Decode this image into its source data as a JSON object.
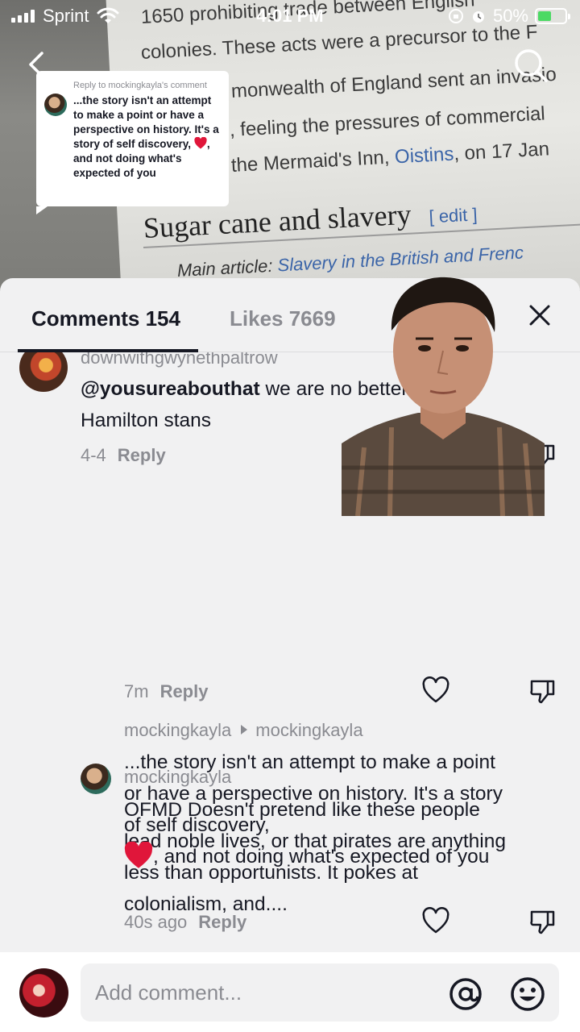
{
  "background": {
    "lines": [
      {
        "text": "1650 prohibiting trade between English",
        "link": ""
      },
      {
        "text": "colonies. These acts were a precursor to the F",
        "link": ""
      },
      {
        "text": "monwealth of England sent an invasio",
        "link": ""
      },
      {
        "text": ", feeling the pressures of commercial",
        "link": ""
      },
      {
        "text": "the Mermaid's Inn, ",
        "link": "Oistins",
        "suffix": ", on 17 Jan"
      }
    ],
    "heading": "Sugar cane and slavery",
    "edit_label": "[ edit ]",
    "sub_prefix": "Main article: ",
    "sub_link": "Slavery in the British and Frenc"
  },
  "status": {
    "carrier": "Sprint",
    "time": "4:01 PM",
    "battery": "50%",
    "battery_level": 0.5,
    "colors": {
      "battery": "#4cd964"
    }
  },
  "reply_sticker": {
    "header": "Reply to mockingkayla's comment",
    "text_before": "...the story isn't an attempt to make a point or have a perspective on history. It's a story of self discovery,",
    "text_after": ", and not doing what's expected of you"
  },
  "sheet": {
    "comments_tab": "Comments 154",
    "likes_tab": "Likes 7669"
  },
  "comments": [
    {
      "username": "downwithgwynethpaltrow",
      "mention": "@yousureabouthat",
      "text": " we are no better than Hamilton stans",
      "time": "4-4",
      "reply_label": "Reply"
    },
    {
      "username": "mockingkayla",
      "text": "OFMD Doesn't pretend like these people lead noble lives, or that pirates are anything less than opportunists. It pokes at colonialism, and....",
      "time": "7m",
      "reply_label": "Reply"
    },
    {
      "username": "mockingkayla",
      "reply_to": "mockingkayla",
      "text_before": "...the story isn't an attempt to make a point or have a perspective on history. It's a story of self discovery,",
      "text_after": ", and not doing what's expected of you",
      "time": "40s ago",
      "reply_label": "Reply"
    }
  ],
  "input": {
    "placeholder": "Add comment..."
  },
  "icons": {
    "back": "chevron-left-icon",
    "search": "search-icon",
    "close": "close-icon",
    "heart": "heart-outline-icon",
    "dislike": "thumbs-down-icon",
    "at": "at-sign-icon",
    "emoji": "smiley-icon",
    "red_heart": "red-heart-emoji-icon"
  }
}
